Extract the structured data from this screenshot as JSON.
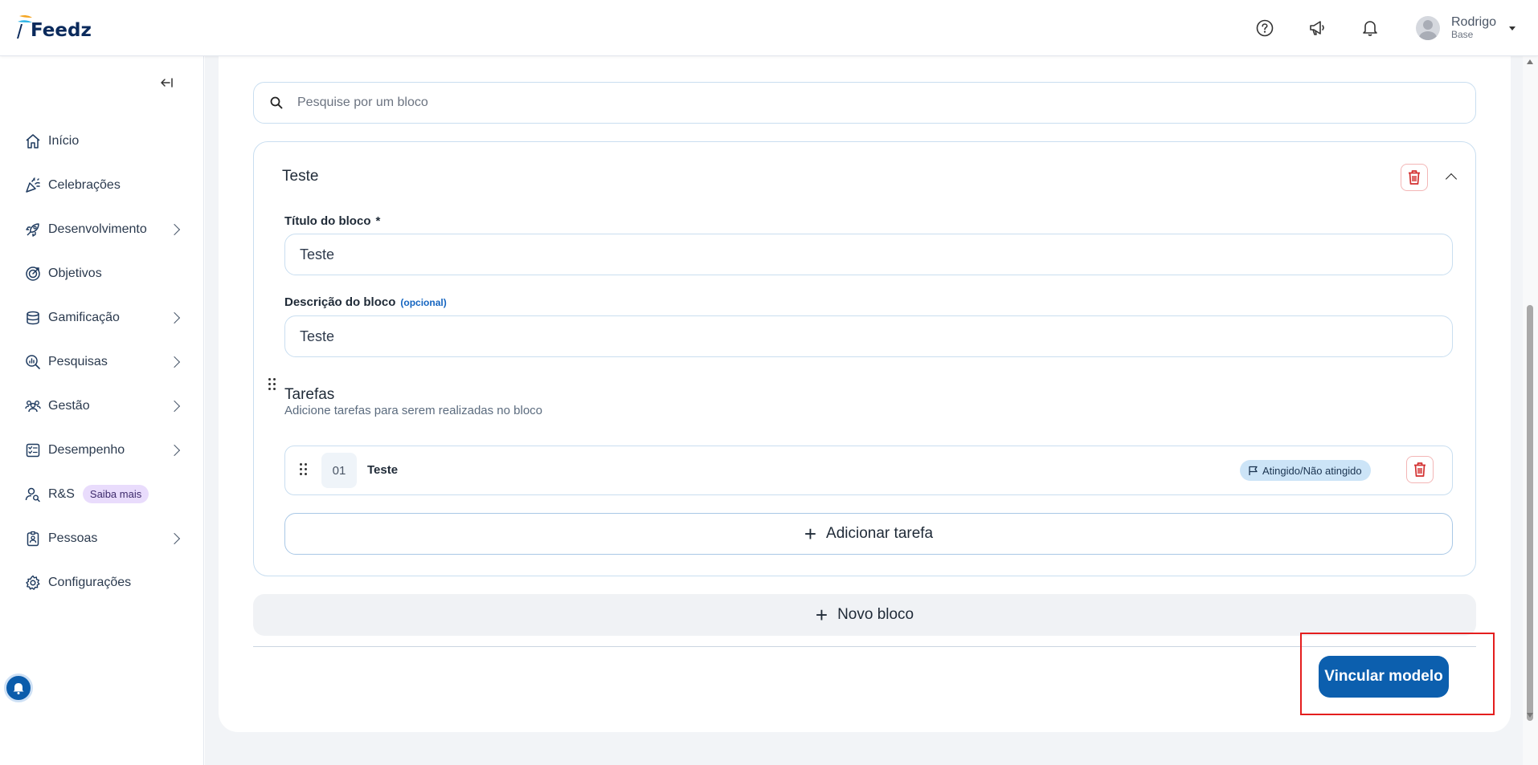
{
  "header": {
    "logo_text": "Feedz",
    "user": {
      "name": "Rodrigo",
      "subtitle": "Base"
    },
    "icons": [
      "help-icon",
      "megaphone-icon",
      "bell-icon"
    ]
  },
  "sidebar": {
    "items": [
      {
        "label": "Início",
        "icon": "home-icon",
        "has_chevron": false
      },
      {
        "label": "Celebrações",
        "icon": "party-icon",
        "has_chevron": false
      },
      {
        "label": "Desenvolvimento",
        "icon": "rocket-icon",
        "has_chevron": true
      },
      {
        "label": "Objetivos",
        "icon": "target-icon",
        "has_chevron": false
      },
      {
        "label": "Gamificação",
        "icon": "coins-icon",
        "has_chevron": true
      },
      {
        "label": "Pesquisas",
        "icon": "search-chart-icon",
        "has_chevron": true
      },
      {
        "label": "Gestão",
        "icon": "people-icon",
        "has_chevron": true
      },
      {
        "label": "Desempenho",
        "icon": "checklist-icon",
        "has_chevron": true
      },
      {
        "label": "R&S",
        "icon": "user-search-icon",
        "has_chevron": false,
        "badge": "Saiba mais"
      },
      {
        "label": "Pessoas",
        "icon": "badge-icon",
        "has_chevron": true
      },
      {
        "label": "Configurações",
        "icon": "gear-icon",
        "has_chevron": false
      }
    ]
  },
  "search": {
    "placeholder": "Pesquise por um bloco"
  },
  "block": {
    "title": "Teste",
    "title_field": {
      "label": "Título do bloco",
      "required_mark": "*",
      "value": "Teste"
    },
    "description_field": {
      "label": "Descrição do bloco",
      "optional": "(opcional)",
      "value": "Teste"
    },
    "tasks": {
      "title": "Tarefas",
      "subtitle": "Adicione tarefas para serem realizadas no bloco",
      "items": [
        {
          "number": "01",
          "name": "Teste",
          "tag": "Atingido/Não atingido"
        }
      ],
      "add_label": "Adicionar tarefa"
    }
  },
  "new_block_label": "Novo bloco",
  "vincular_label": "Vincular modelo",
  "colors": {
    "primary": "#0c5fae",
    "danger": "#d32f2f",
    "highlight": "#e41e1e",
    "badge": "#e9dcfc",
    "tag": "#cce4f7"
  }
}
